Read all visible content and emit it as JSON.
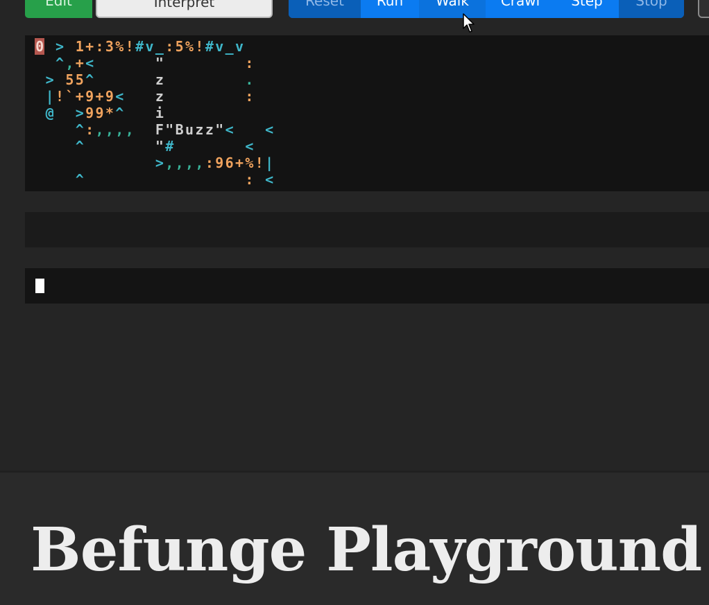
{
  "toolbar": {
    "edit_label": "Edit",
    "interpret_label": "Interpret",
    "reset_label": "Reset",
    "run_label": "Run",
    "walk_label": "Walk",
    "crawl_label": "Crawl",
    "step_label": "Step",
    "stop_label": "Stop"
  },
  "program": {
    "lines": [
      "0 > 1+:3%!#v_:5%!#v_v",
      "  ^,+<      \"        :",
      " > 55^      z        .",
      " |!`+9+9<   z        :",
      " @  >99*^   i",
      "    ^:,,,,  F\"Buzz\"<   <",
      "    ^       \"#       <",
      "            >,,,,:96+%!|",
      "    ^                : <"
    ],
    "pc": {
      "row": 0,
      "col": 0
    }
  },
  "stack": {
    "values": ""
  },
  "output": {
    "text": ""
  },
  "footer": {
    "title": "Befunge Playground"
  },
  "colors": {
    "edit": "#27a04a",
    "run_group": "#0b7bf1",
    "direction": "#3fb6c9",
    "number": "#f0a35e",
    "output": "#39b39a",
    "pc": "#b5574f"
  }
}
